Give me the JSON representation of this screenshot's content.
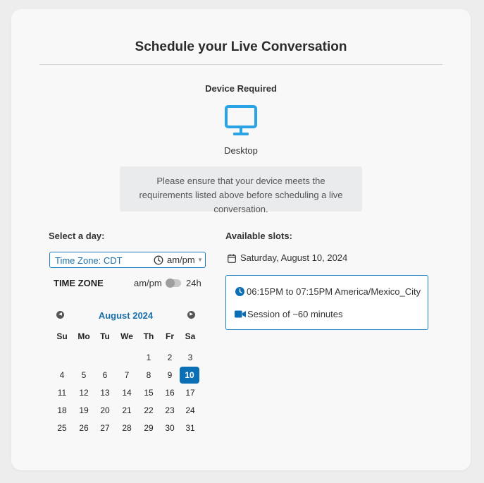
{
  "page": {
    "title": "Schedule your Live Conversation",
    "device_required_label": "Device Required",
    "device_name": "Desktop",
    "device_icon": "desktop-monitor-icon",
    "notice": "Please ensure that your device meets the requirements listed above before scheduling a live conversation."
  },
  "colors": {
    "accent": "#1a7fc1",
    "selected_day": "#0b6fb5",
    "icon_blue": "#29a3e6"
  },
  "left": {
    "heading": "Select a day:",
    "timezone_select": {
      "value": "Time Zone: CDT",
      "format": "am/pm",
      "icon": "clock-icon"
    },
    "timezone_toggle": {
      "label": "TIME ZONE",
      "left_option": "am/pm",
      "right_option": "24h",
      "is_24h": false
    },
    "calendar": {
      "month_label": "August 2024",
      "prev_icon": "chevron-left-icon",
      "next_icon": "chevron-right-icon",
      "weekdays": [
        "Su",
        "Mo",
        "Tu",
        "We",
        "Th",
        "Fr",
        "Sa"
      ],
      "days": [
        "",
        "",
        "",
        "",
        "1",
        "2",
        "3",
        "4",
        "5",
        "6",
        "7",
        "8",
        "9",
        "10",
        "11",
        "12",
        "13",
        "14",
        "15",
        "16",
        "17",
        "18",
        "19",
        "20",
        "21",
        "22",
        "23",
        "24",
        "25",
        "26",
        "27",
        "28",
        "29",
        "30",
        "31"
      ],
      "selected_day": "10"
    }
  },
  "right": {
    "heading": "Available slots:",
    "date": "Saturday, August 10, 2024",
    "date_icon": "calendar-icon",
    "slot": {
      "time": "06:15PM to 07:15PM America/Mexico_City",
      "time_icon": "clock-icon",
      "session": "Session of ~60 minutes",
      "session_icon": "video-camera-icon"
    }
  }
}
